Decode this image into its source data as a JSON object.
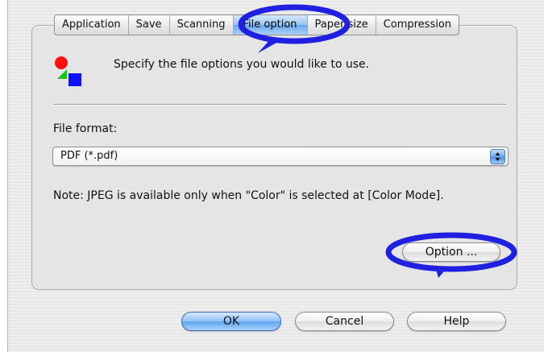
{
  "tabs": [
    "Application",
    "Save",
    "Scanning",
    "File option",
    "Paper size",
    "Compression"
  ],
  "active_tab": "File option",
  "header": {
    "text": "Specify the file options you would like to use."
  },
  "file_format": {
    "label": "File format:",
    "value": "PDF (*.pdf)"
  },
  "note": "Note: JPEG is available only when \"Color\" is selected at [Color Mode].",
  "buttons": {
    "option": "Option ...",
    "ok": "OK",
    "cancel": "Cancel",
    "help": "Help"
  },
  "colors": {
    "highlight": "#2020e0",
    "accent": "#6aa8ec"
  }
}
